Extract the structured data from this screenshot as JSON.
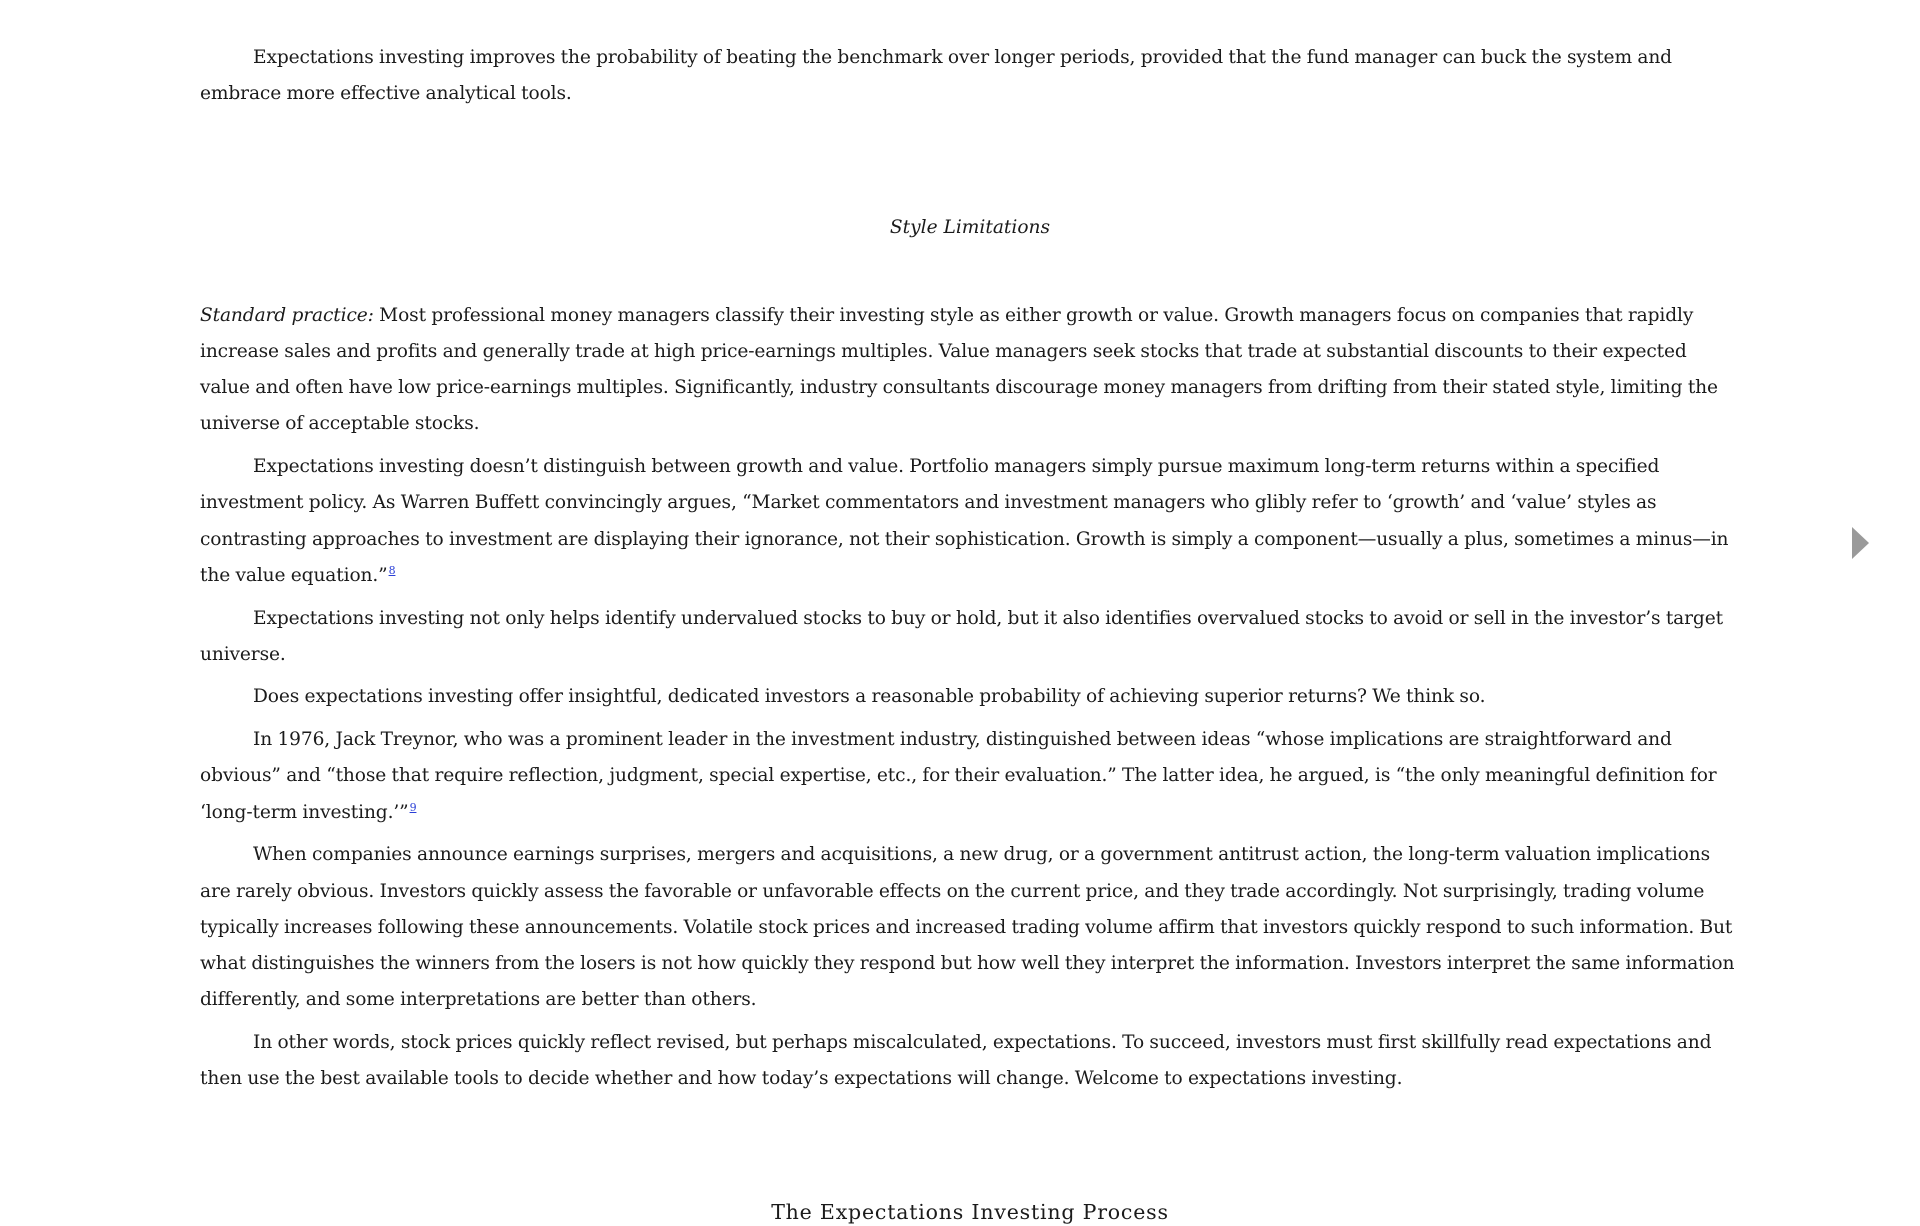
{
  "paragraphs": {
    "p0": "Expectations investing improves the probability of beating the benchmark over longer periods, provided that the fund manager can buck the system and embrace more effective analytical tools.",
    "section_title": "Style Limitations",
    "p1_lead": "Standard practice:",
    "p1_body": " Most professional money managers classify their investing style as either growth or value. Growth managers focus on companies that rapidly increase sales and profits and generally trade at high price-earnings multiples. Value managers seek stocks that trade at substantial discounts to their expected value and often have low price-earnings multiples. Significantly, industry consultants discourage money managers from drifting from their stated style, limiting the universe of acceptable stocks.",
    "p2": "Expectations investing doesn’t distinguish between growth and value. Portfolio managers simply pursue maximum long-term returns within a specified investment policy. As Warren Buffett convincingly argues, “Market commentators and investment managers who glibly refer to ‘growth’ and ‘value’ styles as contrasting approaches to investment are displaying their ignorance, not their sophistication. Growth is simply a component—usually a plus, sometimes a minus—in the value equation.”",
    "p2_note": "8",
    "p3": "Expectations investing not only helps identify undervalued stocks to buy or hold, but it also identifies overvalued stocks to avoid or sell in the investor’s target universe.",
    "p4": "Does expectations investing offer insightful, dedicated investors a reasonable probability of achieving superior returns? We think so.",
    "p5": "In 1976, Jack Treynor, who was a prominent leader in the investment industry, distinguished between ideas “whose implications are straightforward and obvious” and “those that require reflection, judgment, special expertise, etc., for their evaluation.” The latter idea, he argued, is “the only meaningful definition for ‘long-term investing.’”",
    "p5_note": "9",
    "p6": "When companies announce earnings surprises, mergers and acquisitions, a new drug, or a government antitrust action, the long-term valuation implications are rarely obvious. Investors quickly assess the favorable or unfavorable effects on the current price, and they trade accordingly. Not surprisingly, trading volume typically increases following these announcements. Volatile stock prices and increased trading volume affirm that investors quickly respond to such information. But what distinguishes the winners from the losers is not how quickly they respond but how well they interpret the information. Investors interpret the same information differently, and some interpretations are better than others.",
    "p7": "In other words, stock prices quickly reflect revised, but perhaps miscalculated, expectations. To succeed, investors must first skillfully read expectations and then use the best available tools to decide whether and how today’s expectations will change. Welcome to expectations investing.",
    "next_heading": "The Expectations Investing Process"
  },
  "colors": {
    "text": "#1b1b1b",
    "footnote_link": "#2a3fd6",
    "nav_arrow": "#9a9a9a",
    "background": "#ffffff"
  },
  "navigation": {
    "next_page_icon": "triangle-right-icon"
  }
}
